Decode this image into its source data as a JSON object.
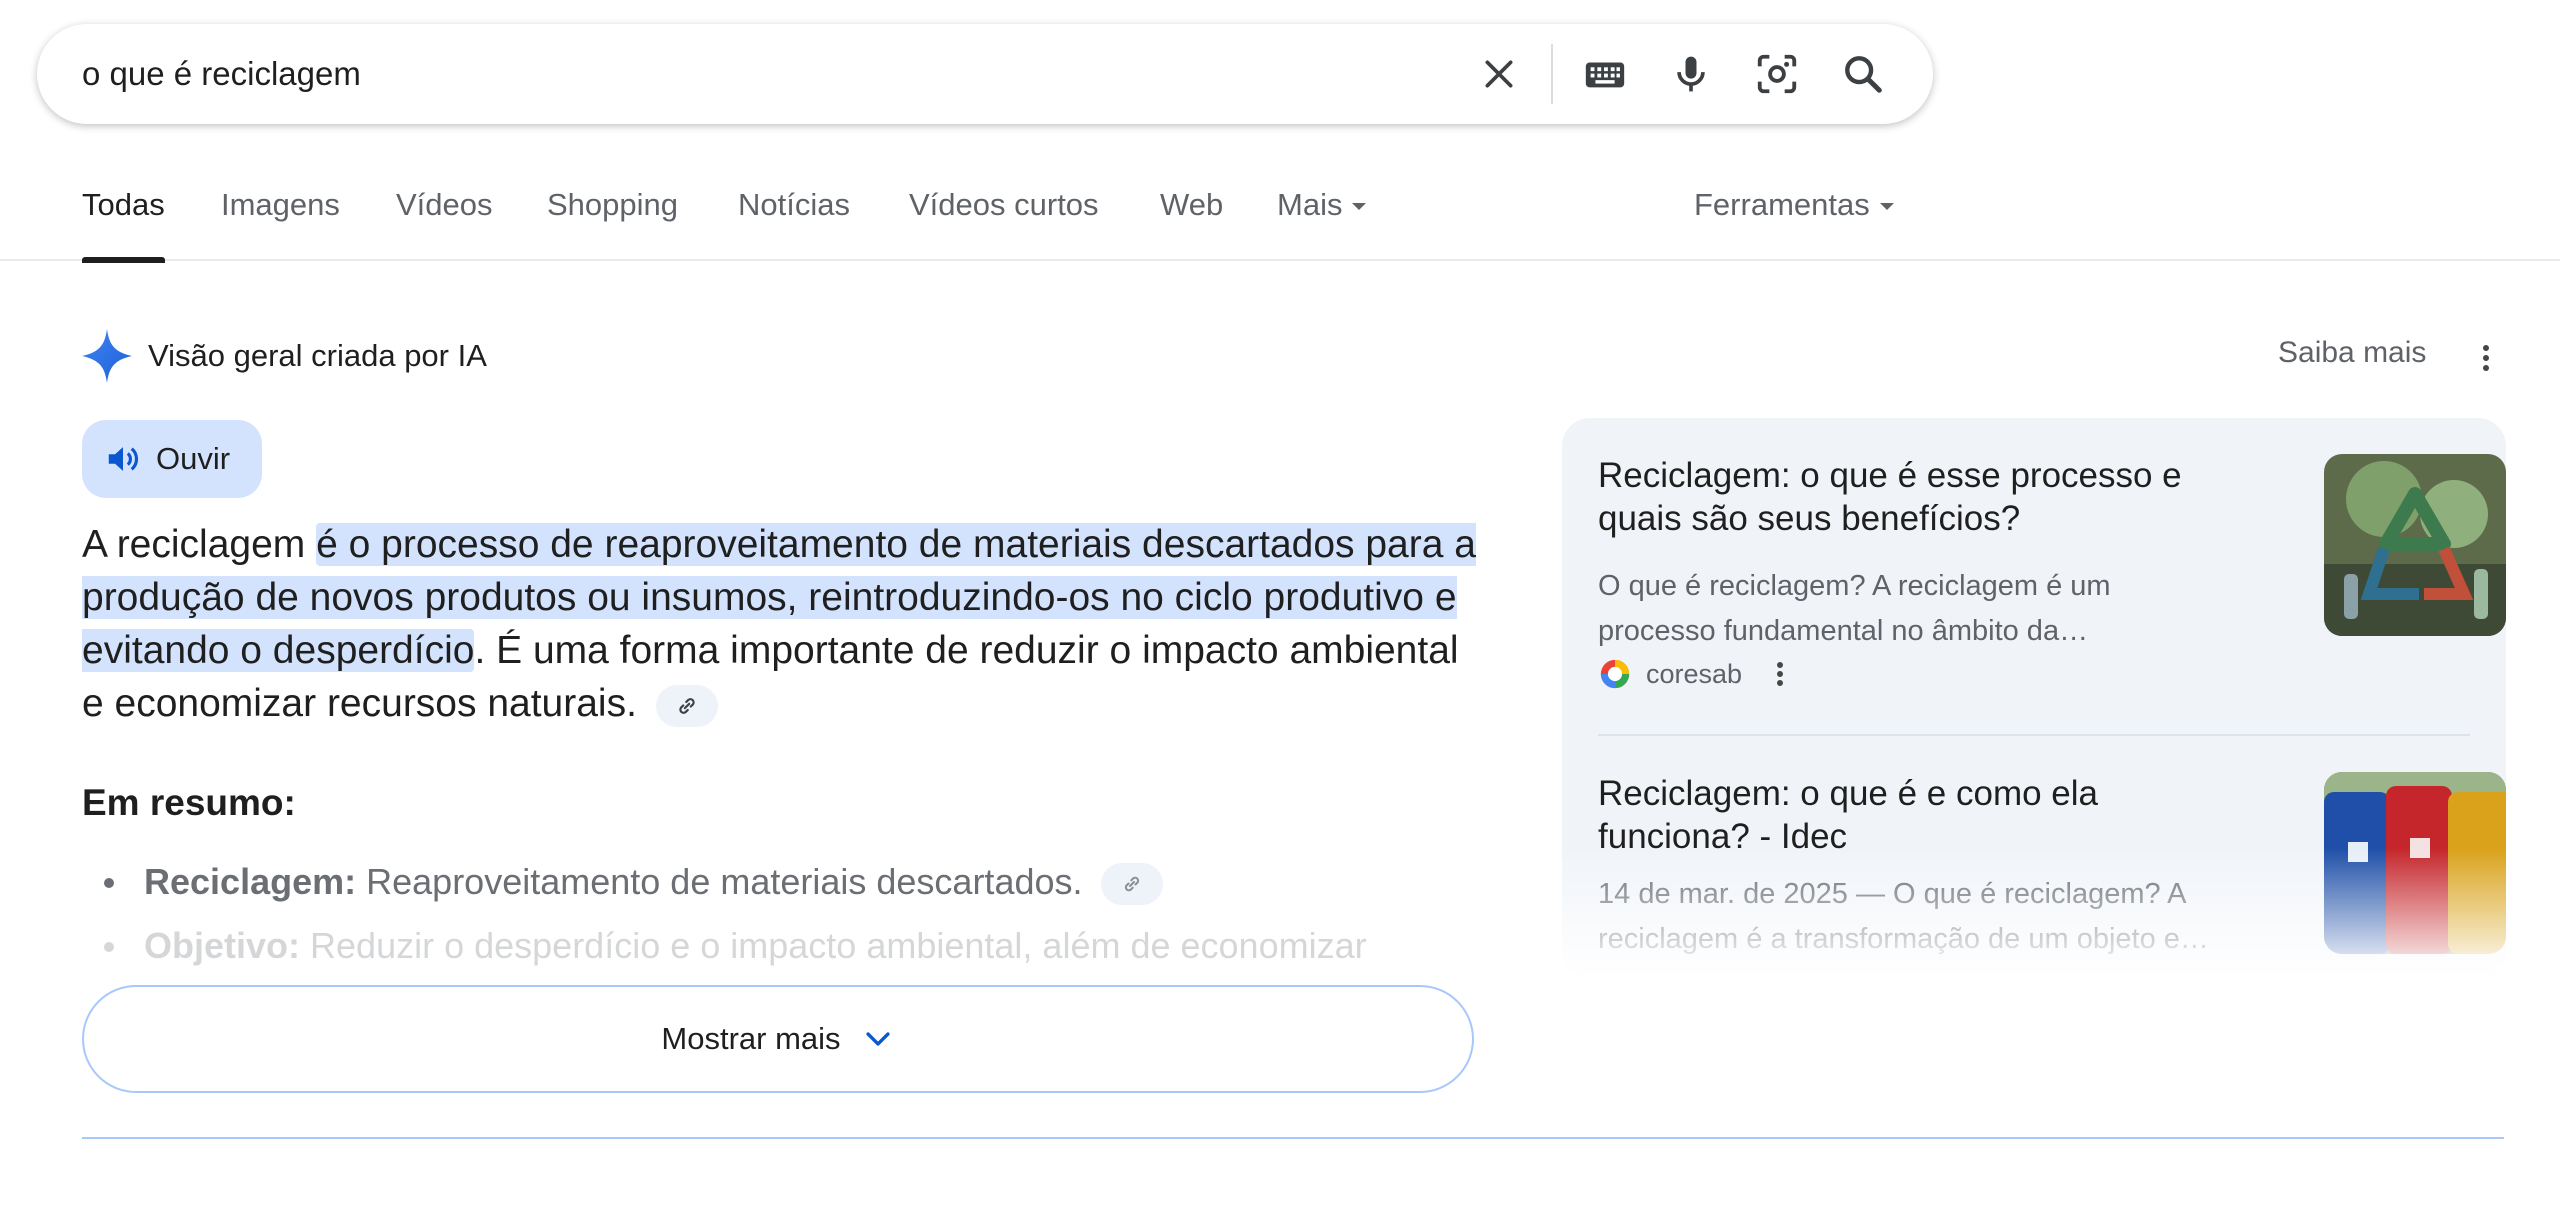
{
  "search": {
    "query": "o que é reciclagem",
    "icons": [
      "close-icon",
      "keyboard-icon",
      "microphone-icon",
      "lens-icon",
      "search-icon"
    ]
  },
  "tabs": [
    {
      "label": "Todas",
      "active": true
    },
    {
      "label": "Imagens"
    },
    {
      "label": "Vídeos"
    },
    {
      "label": "Shopping"
    },
    {
      "label": "Notícias"
    },
    {
      "label": "Vídeos curtos"
    },
    {
      "label": "Web"
    },
    {
      "label": "Mais"
    }
  ],
  "tools_label": "Ferramentas",
  "ai_overview": {
    "title": "Visão geral criada por IA",
    "learn_more": "Saiba mais",
    "listen_label": "Ouvir",
    "summary_start": "A reciclagem ",
    "summary_highlight": "é o processo de reaproveitamento de materiais descartados para a produção de novos produtos ou insumos, reintroduzindo-os no ciclo produtivo e evitando o desperdício",
    "summary_end": ". É uma forma importante de reduzir o impacto ambiental e economizar recursos naturais.",
    "resumo_heading": "Em resumo:",
    "bullets": [
      {
        "key": "Reciclagem:",
        "value": "Reaproveitamento de materiais descartados."
      },
      {
        "key": "Objetivo:",
        "value": "Reduzir o desperdício e o impacto ambiental, além de economizar"
      }
    ],
    "show_more": "Mostrar mais",
    "accent_color": "#0b57d0",
    "highlight_color": "#d3e3fd"
  },
  "sources": [
    {
      "title": "Reciclagem: o que é esse processo e quais são seus benefícios?",
      "snippet_line1": "O que é reciclagem? A reciclagem é um",
      "snippet_line2": "processo fundamental no âmbito da…",
      "site": "coresab"
    },
    {
      "title": "Reciclagem: o que é e como ela funciona? - Idec",
      "snippet_line1": "14 de mar. de 2025 — O que é reciclagem? A",
      "snippet_line2": "reciclagem é a transformação de um objeto e…"
    }
  ]
}
